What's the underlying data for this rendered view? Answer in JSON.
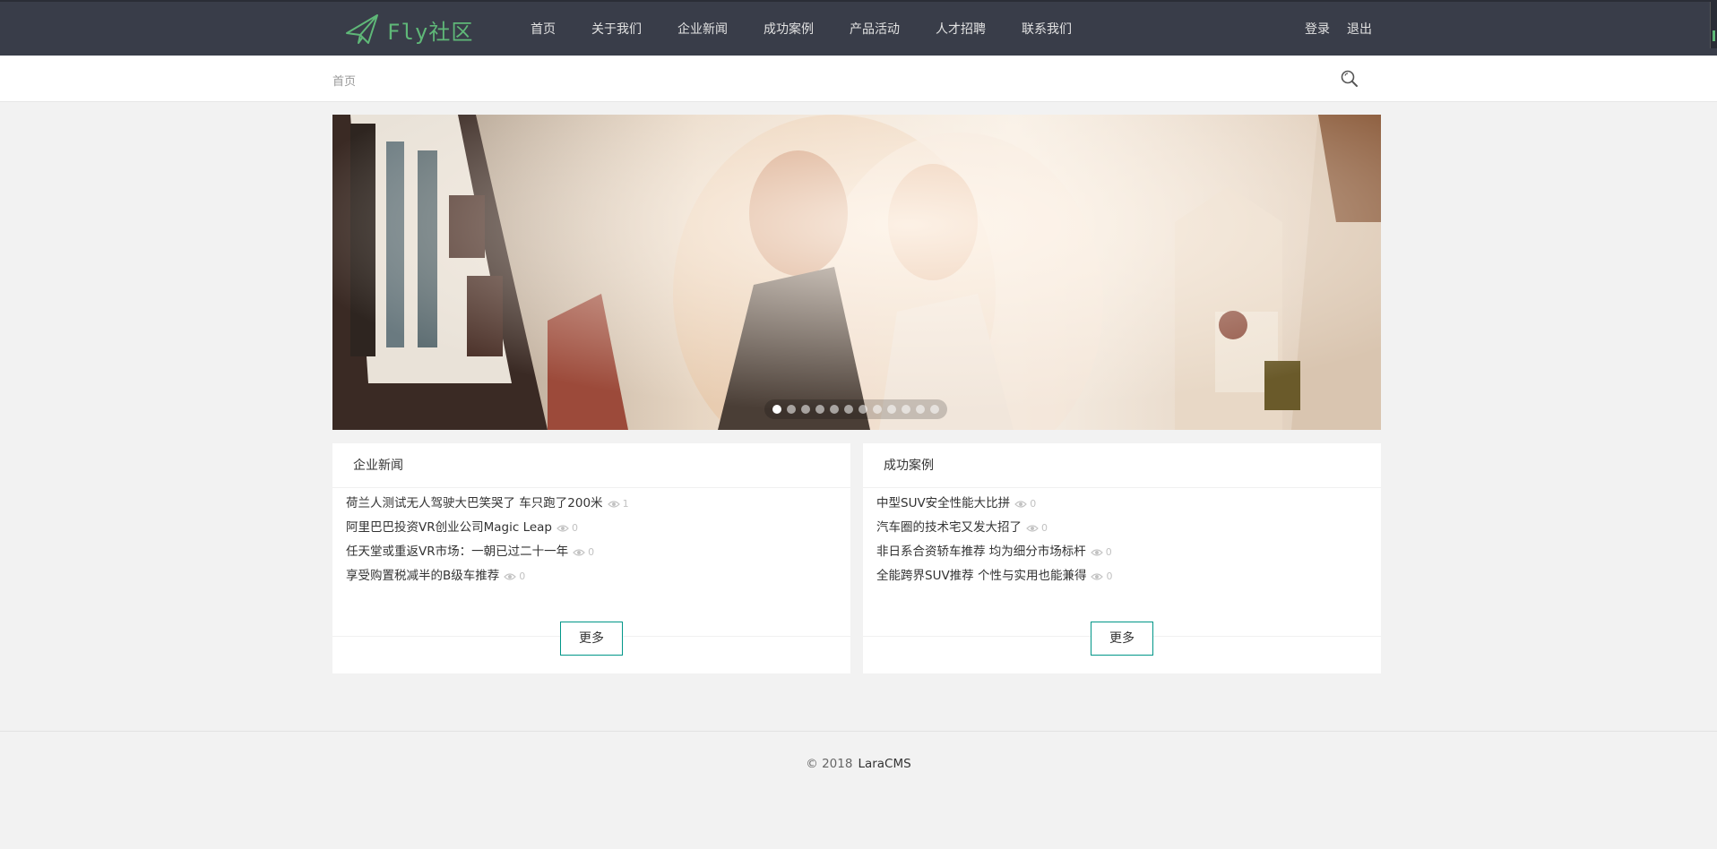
{
  "header": {
    "logo_text": "Fly社区",
    "nav": [
      "首页",
      "关于我们",
      "企业新闻",
      "成功案例",
      "产品活动",
      "人才招聘",
      "联系我们"
    ],
    "login": "登录",
    "logout": "退出"
  },
  "breadcrumb": "首页",
  "banner": {
    "slide_count": 12,
    "active_index": 0
  },
  "news_panel": {
    "title": "企业新闻",
    "items": [
      {
        "title": "荷兰人测试无人驾驶大巴笑哭了 车只跑了200米",
        "views": "1"
      },
      {
        "title": "阿里巴巴投资VR创业公司Magic Leap",
        "views": "0"
      },
      {
        "title": "任天堂或重返VR市场：一朝已过二十一年",
        "views": "0"
      },
      {
        "title": "享受购置税减半的B级车推荐",
        "views": "0"
      }
    ],
    "more": "更多"
  },
  "case_panel": {
    "title": "成功案例",
    "items": [
      {
        "title": "中型SUV安全性能大比拼",
        "views": "0"
      },
      {
        "title": "汽车圈的技术宅又发大招了",
        "views": "0"
      },
      {
        "title": "非日系合资轿车推荐 均为细分市场标杆",
        "views": "0"
      },
      {
        "title": "全能跨界SUV推荐 个性与实用也能兼得",
        "views": "0"
      }
    ],
    "more": "更多"
  },
  "footer": {
    "copyright": "© 2018",
    "brand": "LaraCMS"
  },
  "colors": {
    "header_bg": "#393d49",
    "accent": "#5fb878",
    "button_border": "#009688",
    "page_bg": "#f2f2f2"
  },
  "icons": {
    "logo": "paper-plane-icon",
    "search": "search-icon",
    "views": "eye-icon"
  }
}
